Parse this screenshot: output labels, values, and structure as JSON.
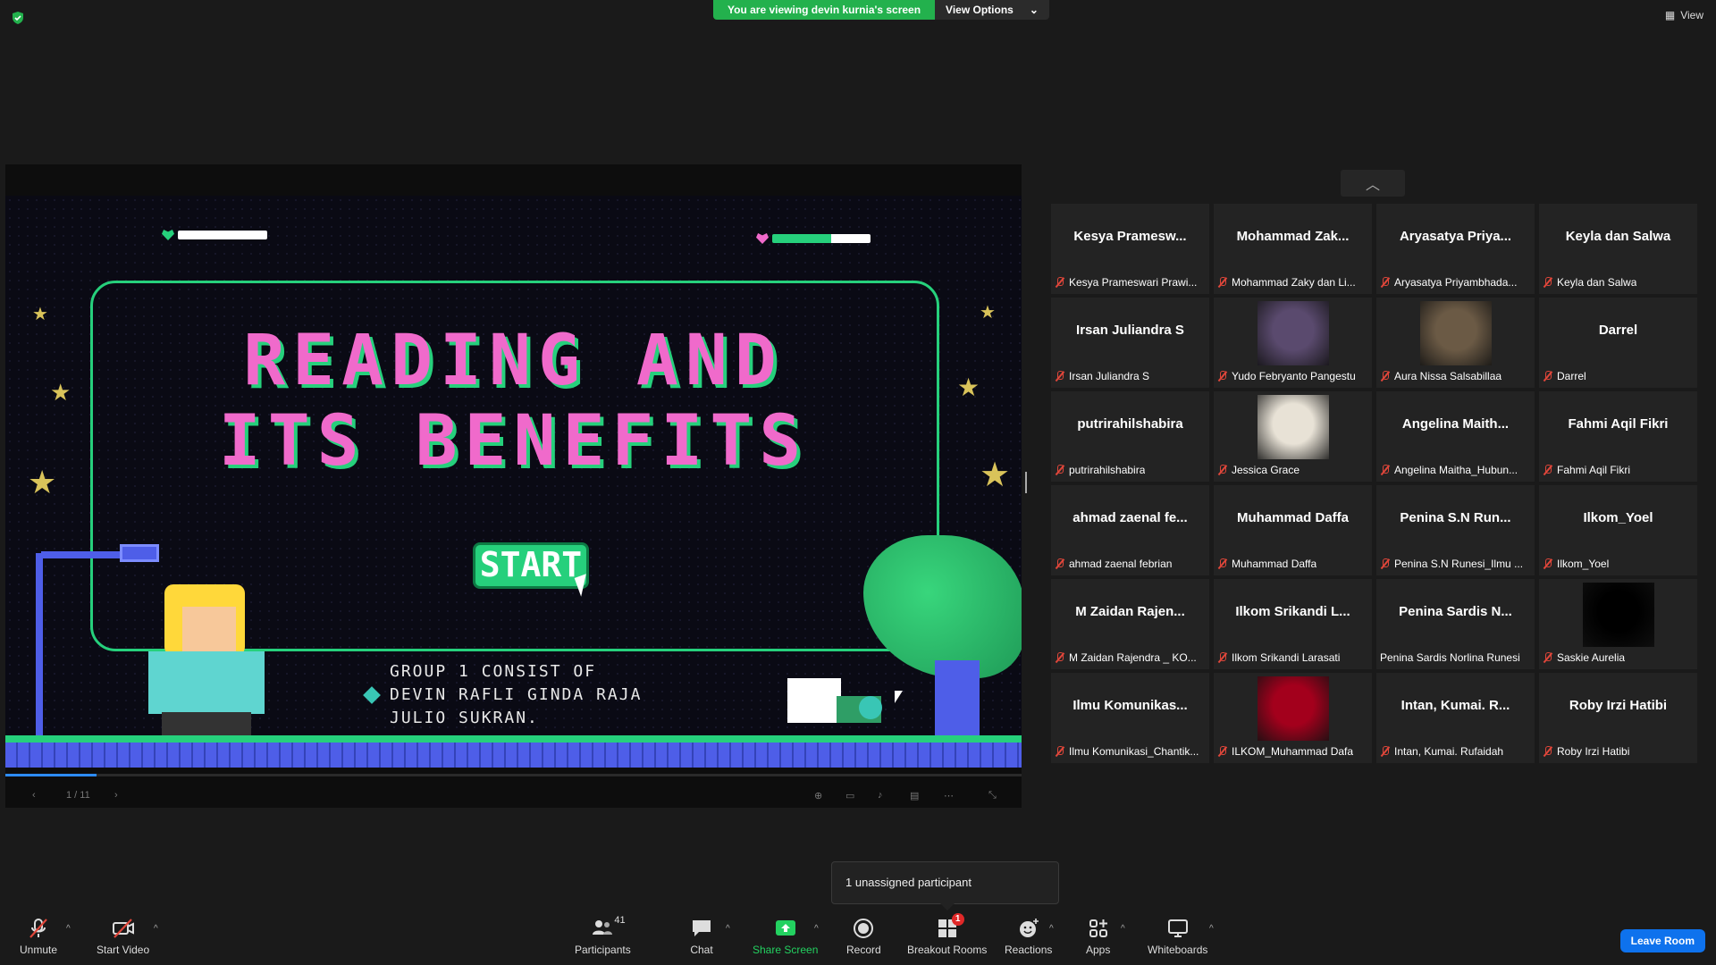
{
  "banner": {
    "viewing": "You are viewing devin kurnia's screen",
    "options": "View Options"
  },
  "view_button": "View",
  "slide": {
    "title_line1": "READING AND",
    "title_line2": "ITS BENEFITS",
    "start": "START",
    "group_lines": [
      "GROUP 1 CONSIST OF",
      "DEVIN RAFLI GINDA RAJA",
      "JULIO SUKRAN."
    ],
    "page": "1 / 11",
    "progress": 0.09
  },
  "gallery": [
    {
      "display": "Kesya Pramesw...",
      "label": "Kesya Prameswari Prawi...",
      "muted": true,
      "video": ""
    },
    {
      "display": "Mohammad Zak...",
      "label": "Mohammad Zaky dan Li...",
      "muted": true,
      "video": ""
    },
    {
      "display": "Aryasatya Priya...",
      "label": "Aryasatya Priyambhada...",
      "muted": true,
      "video": ""
    },
    {
      "display": "Keyla dan Salwa",
      "label": "Keyla dan Salwa",
      "muted": true,
      "video": ""
    },
    {
      "display": "Irsan Juliandra S",
      "label": "Irsan Juliandra S",
      "muted": true,
      "video": ""
    },
    {
      "display": "",
      "label": "Yudo Febryanto Pangestu",
      "muted": true,
      "video": "#5a4a6e"
    },
    {
      "display": "",
      "label": "Aura Nissa Salsabillaa",
      "muted": true,
      "video": "#6b5a45"
    },
    {
      "display": "Darrel",
      "label": "Darrel",
      "muted": true,
      "video": ""
    },
    {
      "display": "putrirahilshabira",
      "label": "putrirahilshabira",
      "muted": true,
      "video": ""
    },
    {
      "display": "",
      "label": "Jessica Grace",
      "muted": true,
      "video": "#e8e2d6"
    },
    {
      "display": "Angelina Maith...",
      "label": "Angelina Maitha_Hubun...",
      "muted": true,
      "video": ""
    },
    {
      "display": "Fahmi Aqil Fikri",
      "label": "Fahmi Aqil Fikri",
      "muted": true,
      "video": ""
    },
    {
      "display": "ahmad zaenal fe...",
      "label": "ahmad zaenal febrian",
      "muted": true,
      "video": ""
    },
    {
      "display": "Muhammad Daffa",
      "label": "Muhammad Daffa",
      "muted": true,
      "video": ""
    },
    {
      "display": "Penina S.N Run...",
      "label": "Penina S.N Runesi_Ilmu ...",
      "muted": true,
      "video": ""
    },
    {
      "display": "Ilkom_Yoel",
      "label": "Ilkom_Yoel",
      "muted": true,
      "video": ""
    },
    {
      "display": "M Zaidan Rajen...",
      "label": "M Zaidan Rajendra _ KO...",
      "muted": true,
      "video": ""
    },
    {
      "display": "Ilkom Srikandi L...",
      "label": "Ilkom Srikandi Larasati",
      "muted": true,
      "video": ""
    },
    {
      "display": "Penina Sardis N...",
      "label": "Penina Sardis Norlina Runesi",
      "muted": false,
      "video": ""
    },
    {
      "display": "",
      "label": "Saskie Aurelia",
      "muted": true,
      "video": "#000000"
    },
    {
      "display": "Ilmu Komunikas...",
      "label": "Ilmu Komunikasi_Chantik...",
      "muted": true,
      "video": ""
    },
    {
      "display": "",
      "label": "ILKOM_Muhammad Dafa",
      "muted": true,
      "video": "#a3001c"
    },
    {
      "display": "Intan, Kumai. R...",
      "label": "Intan, Kumai. Rufaidah",
      "muted": true,
      "video": ""
    },
    {
      "display": "Roby Irzi Hatibi",
      "label": "Roby Irzi Hatibi",
      "muted": true,
      "video": ""
    }
  ],
  "tooltip": "1 unassigned participant",
  "toolbar": {
    "unmute": "Unmute",
    "start_video": "Start Video",
    "participants": "Participants",
    "participants_count": "41",
    "chat": "Chat",
    "share_screen": "Share Screen",
    "record": "Record",
    "breakout_rooms": "Breakout Rooms",
    "breakout_badge": "1",
    "reactions": "Reactions",
    "apps": "Apps",
    "whiteboards": "Whiteboards",
    "leave": "Leave Room"
  },
  "colors": {
    "accent_green": "#23b14d",
    "slide_pink": "#f06acb",
    "slide_green": "#26d07c",
    "leave_blue": "#0e72ed",
    "mute_red": "#e0463a"
  }
}
